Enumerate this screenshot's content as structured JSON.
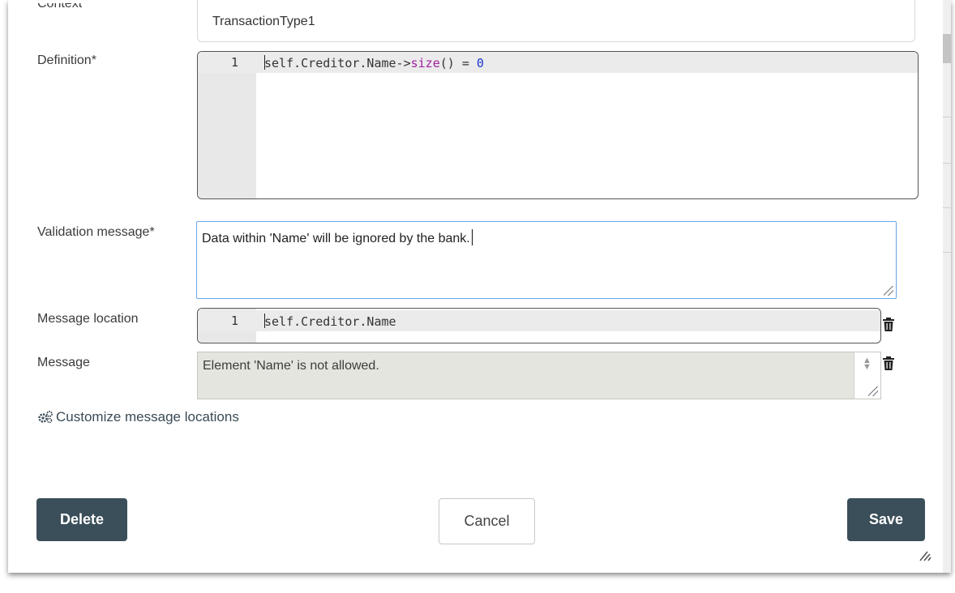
{
  "form": {
    "context": {
      "label": "Context",
      "value": "TransactionType1"
    },
    "definition": {
      "label": "Definition*",
      "line_number": "1",
      "code_prefix": "self.Creditor.Name->",
      "code_keyword": "size",
      "code_mid": "() = ",
      "code_number": "0"
    },
    "validation_message": {
      "label": "Validation message*",
      "value": "Data within 'Name' will be ignored by the bank."
    },
    "message_location": {
      "label": "Message location",
      "line_number": "1",
      "code": "self.Creditor.Name"
    },
    "message": {
      "label": "Message",
      "value": "Element 'Name' is not allowed."
    },
    "customize_link": {
      "label": "Customize message locations",
      "icon": "gears-icon"
    }
  },
  "buttons": {
    "delete": "Delete",
    "cancel": "Cancel",
    "save": "Save"
  },
  "colors": {
    "dark_button": "#3b4f5a",
    "focus_border": "#6aa6ea",
    "keyword": "#a020a0",
    "number": "#1a35d0"
  }
}
